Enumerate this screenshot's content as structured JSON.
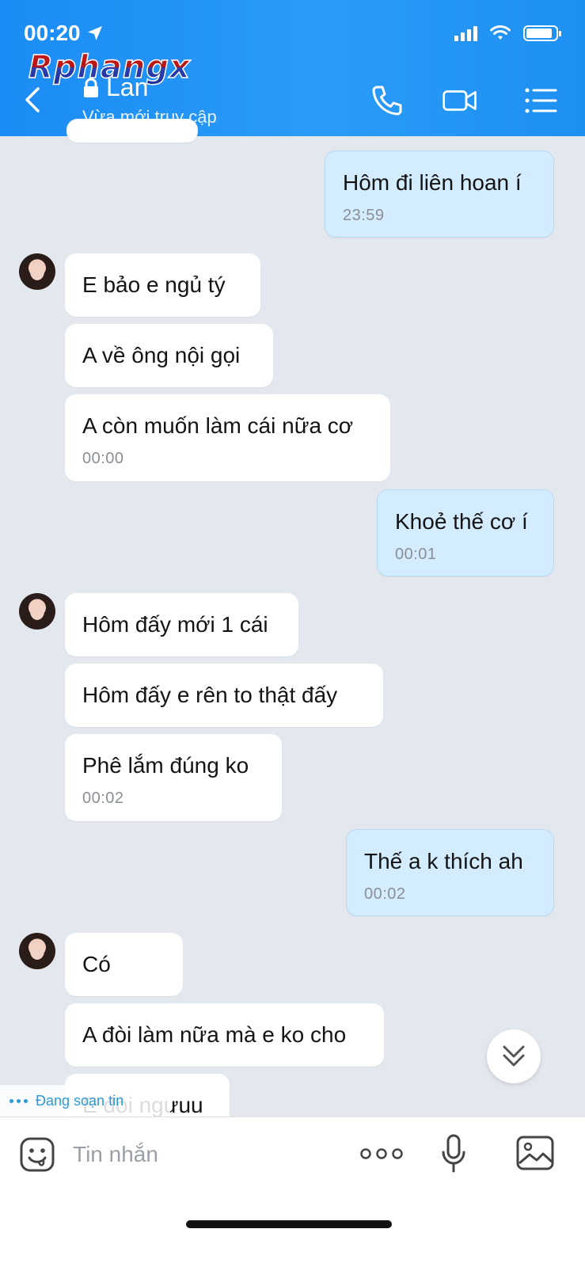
{
  "status_bar": {
    "time": "00:20"
  },
  "watermark": "Rphangx",
  "header": {
    "contact_name": "Lan",
    "contact_status": "Vừa mới truy cập"
  },
  "messages": [
    {
      "sender": "me",
      "text": "Hôm đi liên hoan í",
      "time": "23:59"
    },
    {
      "sender": "them",
      "text": "E bảo e ngủ tý",
      "time": ""
    },
    {
      "sender": "them",
      "text": "A về ông nội gọi",
      "time": ""
    },
    {
      "sender": "them",
      "text": "A còn muốn làm cái nữa cơ",
      "time": "00:00"
    },
    {
      "sender": "me",
      "text": "Khoẻ thế cơ í",
      "time": "00:01"
    },
    {
      "sender": "them",
      "text": "Hôm đấy mới 1 cái",
      "time": ""
    },
    {
      "sender": "them",
      "text": "Hôm đấy e rên to thật đấy",
      "time": ""
    },
    {
      "sender": "them",
      "text": "Phê lắm đúng ko",
      "time": "00:02"
    },
    {
      "sender": "me",
      "text": "Thế a k thích ah",
      "time": "00:02"
    },
    {
      "sender": "them",
      "text": "Có",
      "time": ""
    },
    {
      "sender": "them",
      "text": "A đòi làm nữa mà e ko cho",
      "time": ""
    },
    {
      "sender": "them",
      "text": "E đòi ngưuu",
      "time": ""
    }
  ],
  "typing_indicator": "Đang soạn tin",
  "composer": {
    "placeholder": "Tin nhắn"
  },
  "colors": {
    "header_blue": "#1a8cf5",
    "my_bubble": "#d4ecff",
    "their_bubble": "#ffffff",
    "chat_background": "#e3e7ee"
  },
  "icons": [
    "location-arrow-icon",
    "signal-icon",
    "wifi-icon",
    "battery-icon",
    "back-icon",
    "lock-icon",
    "phone-icon",
    "video-call-icon",
    "menu-list-icon",
    "chevrons-down-icon",
    "emoji-sticker-icon",
    "more-dots-icon",
    "microphone-icon",
    "image-icon"
  ]
}
